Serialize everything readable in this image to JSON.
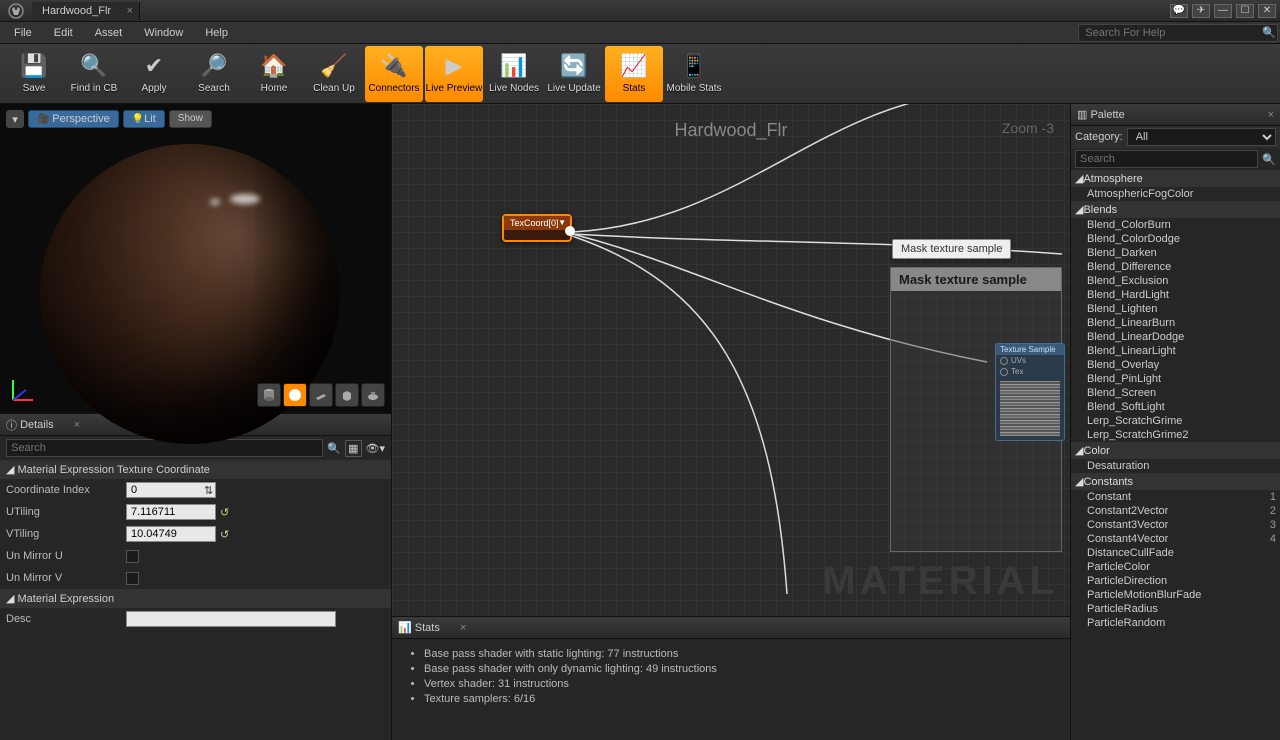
{
  "titlebar": {
    "tab_title": "Hardwood_Flr"
  },
  "menu": {
    "items": [
      "File",
      "Edit",
      "Asset",
      "Window",
      "Help"
    ],
    "search_placeholder": "Search For Help"
  },
  "toolbar": {
    "buttons": [
      {
        "label": "Save",
        "active": false
      },
      {
        "label": "Find in CB",
        "active": false
      },
      {
        "label": "Apply",
        "active": false
      },
      {
        "label": "Search",
        "active": false
      },
      {
        "label": "Home",
        "active": false
      },
      {
        "label": "Clean Up",
        "active": false
      },
      {
        "label": "Connectors",
        "active": true
      },
      {
        "label": "Live Preview",
        "active": true
      },
      {
        "label": "Live Nodes",
        "active": false
      },
      {
        "label": "Live Update",
        "active": false
      },
      {
        "label": "Stats",
        "active": true
      },
      {
        "label": "Mobile Stats",
        "active": false
      }
    ]
  },
  "viewport": {
    "perspective": "Perspective",
    "lit": "Lit",
    "show": "Show"
  },
  "details": {
    "panel_title": "Details",
    "search_placeholder": "Search",
    "section1": "Material Expression Texture Coordinate",
    "coord_index_label": "Coordinate Index",
    "coord_index_value": "0",
    "utiling_label": "UTiling",
    "utiling_value": "7.116711",
    "vtiling_label": "VTiling",
    "vtiling_value": "10.04749",
    "unmirror_u_label": "Un Mirror U",
    "unmirror_v_label": "Un Mirror V",
    "section2": "Material Expression",
    "desc_label": "Desc"
  },
  "graph": {
    "title": "Hardwood_Flr",
    "zoom": "Zoom -3",
    "watermark": "MATERIAL",
    "node_texcoord": "TexCoord[0]",
    "tooltip": "Mask texture sample",
    "comment_title": "Mask texture sample",
    "tex_sample_title": "Texture Sample",
    "tex_sample_uvs": "UVs",
    "tex_sample_tex": "Tex"
  },
  "stats": {
    "panel_title": "Stats",
    "lines": [
      "Base pass shader with static lighting: 77 instructions",
      "Base pass shader with only dynamic lighting: 49 instructions",
      "Vertex shader: 31 instructions",
      "Texture samplers: 6/16"
    ]
  },
  "palette": {
    "panel_title": "Palette",
    "category_label": "Category:",
    "category_value": "All",
    "search_placeholder": "Search",
    "groups": [
      {
        "name": "Atmosphere",
        "items": [
          {
            "n": "AtmosphericFogColor"
          }
        ]
      },
      {
        "name": "Blends",
        "items": [
          {
            "n": "Blend_ColorBurn"
          },
          {
            "n": "Blend_ColorDodge"
          },
          {
            "n": "Blend_Darken"
          },
          {
            "n": "Blend_Difference"
          },
          {
            "n": "Blend_Exclusion"
          },
          {
            "n": "Blend_HardLight"
          },
          {
            "n": "Blend_Lighten"
          },
          {
            "n": "Blend_LinearBurn"
          },
          {
            "n": "Blend_LinearDodge"
          },
          {
            "n": "Blend_LinearLight"
          },
          {
            "n": "Blend_Overlay"
          },
          {
            "n": "Blend_PinLight"
          },
          {
            "n": "Blend_Screen"
          },
          {
            "n": "Blend_SoftLight"
          },
          {
            "n": "Lerp_ScratchGrime"
          },
          {
            "n": "Lerp_ScratchGrime2"
          }
        ]
      },
      {
        "name": "Color",
        "items": [
          {
            "n": "Desaturation"
          }
        ]
      },
      {
        "name": "Constants",
        "items": [
          {
            "n": "Constant",
            "v": "1"
          },
          {
            "n": "Constant2Vector",
            "v": "2"
          },
          {
            "n": "Constant3Vector",
            "v": "3"
          },
          {
            "n": "Constant4Vector",
            "v": "4"
          },
          {
            "n": "DistanceCullFade"
          },
          {
            "n": "ParticleColor"
          },
          {
            "n": "ParticleDirection"
          },
          {
            "n": "ParticleMotionBlurFade"
          },
          {
            "n": "ParticleRadius"
          },
          {
            "n": "ParticleRandom"
          }
        ]
      }
    ]
  }
}
